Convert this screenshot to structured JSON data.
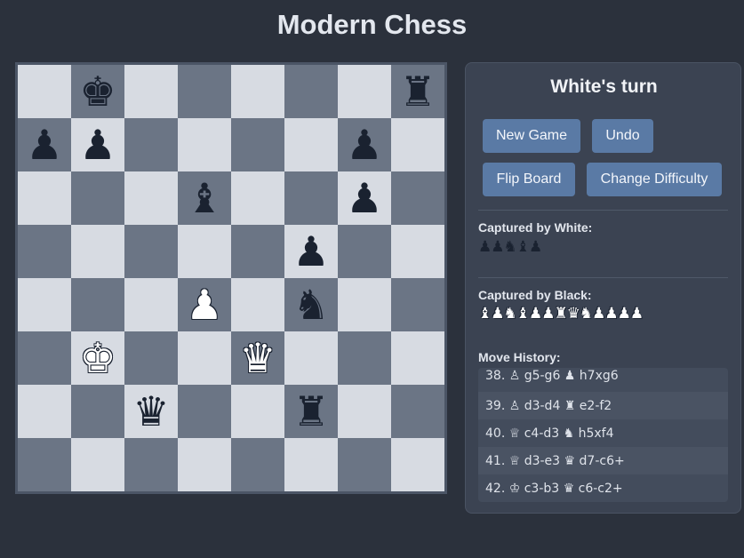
{
  "title": "Modern Chess",
  "board": {
    "rows": [
      [
        "",
        "bK",
        "",
        "",
        "",
        "",
        "",
        "bR"
      ],
      [
        "bP",
        "bP",
        "",
        "",
        "",
        "",
        "bP",
        ""
      ],
      [
        "",
        "",
        "",
        "bB",
        "",
        "",
        "bP",
        ""
      ],
      [
        "",
        "",
        "",
        "",
        "",
        "bP",
        "",
        ""
      ],
      [
        "",
        "",
        "",
        "wP",
        "",
        "bN",
        "",
        ""
      ],
      [
        "",
        "wK",
        "",
        "",
        "wQ",
        "",
        "",
        ""
      ],
      [
        "",
        "",
        "bQ",
        "",
        "",
        "bR",
        "",
        ""
      ],
      [
        "",
        "",
        "",
        "",
        "",
        "",
        "",
        ""
      ]
    ],
    "colors": {
      "light": "#d7dbe2",
      "dark": "#6b7585"
    }
  },
  "panel": {
    "turn": "White's turn",
    "buttons": {
      "new_game": "New Game",
      "undo": "Undo",
      "flip_board": "Flip Board",
      "change_difficulty": "Change Difficulty"
    },
    "captured_by_white_label": "Captured by White:",
    "captured_by_white": "♟♟♞♝♟",
    "captured_by_black_label": "Captured by Black:",
    "captured_by_black": "♝♟♞♝♟♟♜♛♞♟♟♟♟",
    "move_history_label": "Move History:",
    "moves": [
      "38. ♙ g5-g6 ♟ h7xg6",
      "39. ♙ d3-d4 ♜ e2-f2",
      "40. ♕ c4-d3 ♞ h5xf4",
      "41. ♕ d3-e3 ♛ d7-c6+",
      "42. ♔ c3-b3 ♛ c6-c2+"
    ]
  },
  "theme": {
    "background": "#2b313c",
    "button": "#5a7aa5",
    "panel": "#3b4352"
  }
}
